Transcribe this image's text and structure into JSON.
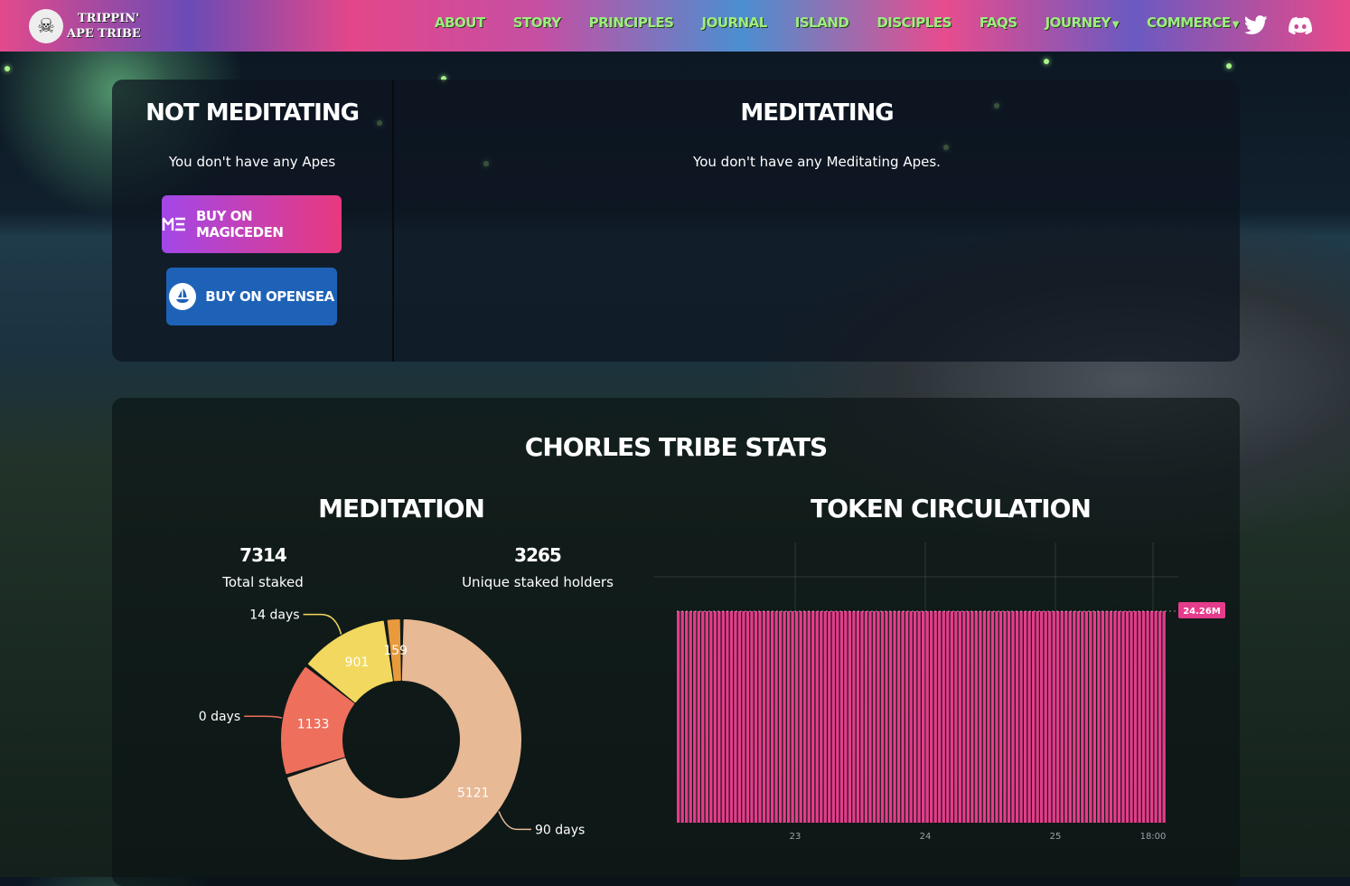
{
  "nav": {
    "logo_line1": "TRIPPIN'",
    "logo_line2": "APE TRIBE",
    "links": [
      {
        "label": "ABOUT"
      },
      {
        "label": "STORY"
      },
      {
        "label": "PRINCIPLES"
      },
      {
        "label": "JOURNAL"
      },
      {
        "label": "ISLAND"
      },
      {
        "label": "DISCIPLES"
      },
      {
        "label": "FAQS"
      },
      {
        "label": "JOURNEY",
        "dropdown": true
      },
      {
        "label": "COMMERCE",
        "dropdown": true
      }
    ],
    "social": [
      "twitter-icon",
      "discord-icon"
    ]
  },
  "not_meditating": {
    "title": "NOT MEDITATING",
    "message": "You don't have any Apes",
    "buy_magiceden": "BUY ON MAGICEDEN",
    "buy_opensea": "BUY ON OPENSEA"
  },
  "meditating": {
    "title": "MEDITATING",
    "message": "You don't have any Meditating Apes."
  },
  "stats": {
    "title": "CHORLES TRIBE STATS",
    "meditation_title": "MEDITATION",
    "total_staked": "7314",
    "total_staked_label": "Total staked",
    "unique_holders": "3265",
    "unique_holders_label": "Unique staked holders",
    "token_title": "TOKEN CIRCULATION"
  },
  "chart_data": [
    {
      "type": "pie",
      "variant": "donut",
      "categories": [
        "90 days",
        "0 days",
        "14 days",
        ""
      ],
      "values": [
        5121,
        1133,
        901,
        159
      ],
      "colors": [
        "#e8b995",
        "#ee6f5c",
        "#f2d85e",
        "#e99a3c"
      ]
    },
    {
      "type": "bar",
      "x_ticks": [
        "23",
        "24",
        "25",
        "18:00"
      ],
      "last_value_label": "24.26M",
      "color": "#e53c8b"
    }
  ]
}
